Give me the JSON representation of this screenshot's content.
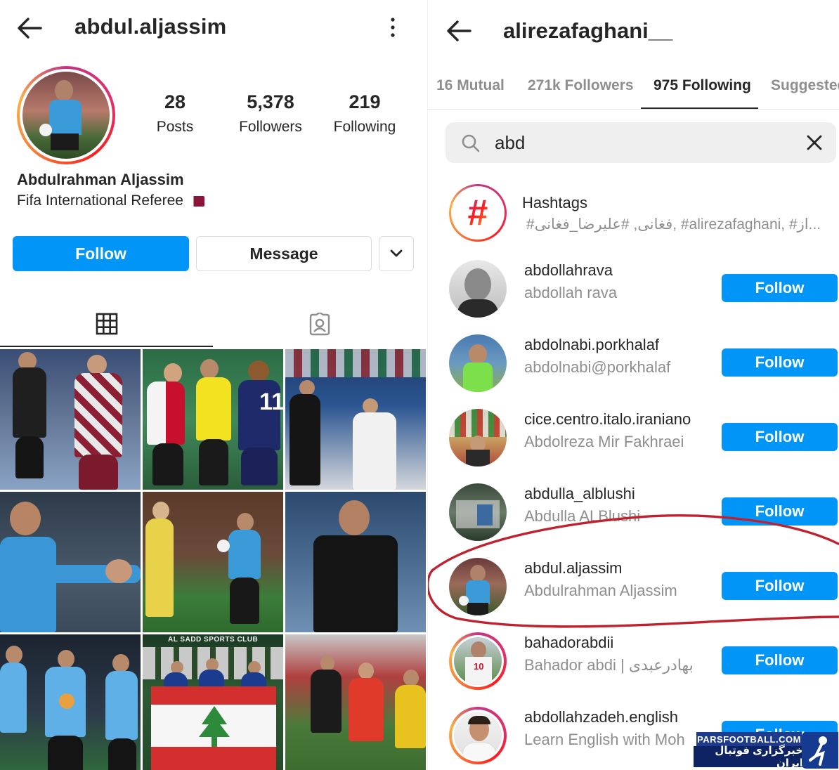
{
  "left": {
    "username": "abdul.aljassim",
    "stats": [
      {
        "value": "28",
        "label": "Posts"
      },
      {
        "value": "5,378",
        "label": "Followers"
      },
      {
        "value": "219",
        "label": "Following"
      }
    ],
    "full_name": "Abdulrahman Aljassim",
    "bio": "Fifa International Referee",
    "follow_label": "Follow",
    "message_label": "Message",
    "grid_icon": "grid-icon",
    "tagged_icon": "tagged-icon",
    "photo_texts": {
      "sadd_banner": "AL SADD SPORTS CLUB",
      "jersey_number": "11"
    }
  },
  "right": {
    "username": "alirezafaghani__",
    "tabs": [
      {
        "label": "16 Mutual"
      },
      {
        "label": "271k Followers"
      },
      {
        "label": "975 Following"
      },
      {
        "label": "Suggested"
      }
    ],
    "search": {
      "value": "abd"
    },
    "hashtags": {
      "title": "Hashtags",
      "subtitle": "#فغانی, #علیرضا_فغانی, #alirezafaghani, #از..."
    },
    "results": [
      {
        "username": "abdollahrava",
        "name": "abdollah rava",
        "button": "Follow"
      },
      {
        "username": "abdolnabi.porkhalaf",
        "name": "abdolnabi@porkhalaf",
        "button": "Follow"
      },
      {
        "username": "cice.centro.italo.iraniano",
        "name": "Abdolreza Mir Fakhraei",
        "button": "Follow"
      },
      {
        "username": "abdulla_alblushi",
        "name": "Abdulla ALBlushi",
        "button": "Follow"
      },
      {
        "username": "abdul.aljassim",
        "name": "Abdulrahman Aljassim",
        "button": "Follow"
      },
      {
        "username": "bahadorabdii",
        "name": "Bahador abdi | بهادرعبدی",
        "button": "Follow"
      },
      {
        "username": "abdollahzadeh.english",
        "name": "Learn English with Moh",
        "button": "Follow"
      }
    ]
  },
  "watermark": {
    "site": "PARSFOOTBALL.COM",
    "tagline": "خبرگزاری فوتبال ایران"
  },
  "colors": {
    "accent": "#0095f6",
    "annotation": "#c0212f"
  }
}
